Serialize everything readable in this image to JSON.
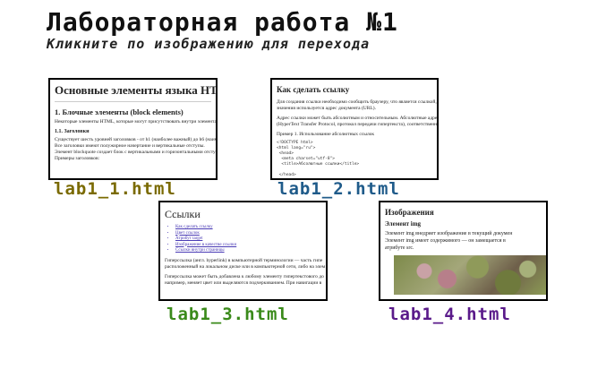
{
  "header": {
    "title": "Лабораторная работа №1",
    "subtitle": "Кликните по изображению для перехода"
  },
  "cards": [
    {
      "caption": "lab1_1.html",
      "color": "#7a6a00",
      "preview": {
        "heading": "Основные элементы языка HTML",
        "section": "1. Блочные элементы (block elements)",
        "intro": "Некоторые элементы HTML, которые могут присутствовать внутри элемента",
        "subsection": "1.1. Заголовки",
        "lines": [
          "Существует шесть уровней заголовков - от h1 (наиболее важный) до h6 (наименее",
          "Все заголовки имеют полужирное начертание и вертикальные отступы.",
          "Элемент blockquote создает блок с вертикальными и горизонтальными отступами",
          "Примеры заголовков:"
        ]
      }
    },
    {
      "caption": "lab1_2.html",
      "color": "#1f5b8a",
      "preview": {
        "heading": "Как сделать ссылку",
        "p1": [
          "Для создания ссылки необходимо сообщить браузеру, что является ссылкой,",
          "значения используется адрес документа (URL)."
        ],
        "p2": [
          "Адрес ссылки может быть абсолютным и относительным. Абсолютные адреса",
          "(HyperText Transfer Protocol, протокол передачи гипертекста), соответственно"
        ],
        "example": "Пример 1. Использование абсолютных ссылок",
        "code": "<!DOCTYPE html>\n<html lang=\"ru\">\n <head>\n  <meta charset=\"utf-8\">\n  <title>Абсолютные ссылки</title>\n\n </head>"
      }
    },
    {
      "caption": "lab1_3.html",
      "color": "#3a8a1a",
      "preview": {
        "heading": "Ссылки",
        "links": [
          "Как сделать ссылку",
          "Цвет ссылок",
          "Атрибут target",
          "Изображение в качестве ссылки",
          "Ссылки внутри страницы"
        ],
        "p1": [
          "Гиперссылка (англ. hyperlink) в компьютерной терминологии — часть гипе",
          "расположенный на локальном диске или в компьютерной сети, либо на элем"
        ],
        "p2": [
          "Гиперссылка может быть добавлена к любому элементу гипертекстового до",
          "например, меняет цвет или выделяются подчеркиванием. При навигации в"
        ]
      }
    },
    {
      "caption": "lab1_4.html",
      "color": "#5a1a8a",
      "preview": {
        "heading": "Изображения",
        "element": "Элемент img",
        "lines": [
          "Элемент img внедряет изображение в текущий докумен",
          "Элемент img имеет содержимого — он замещается в",
          "атрибуте src."
        ]
      }
    }
  ]
}
